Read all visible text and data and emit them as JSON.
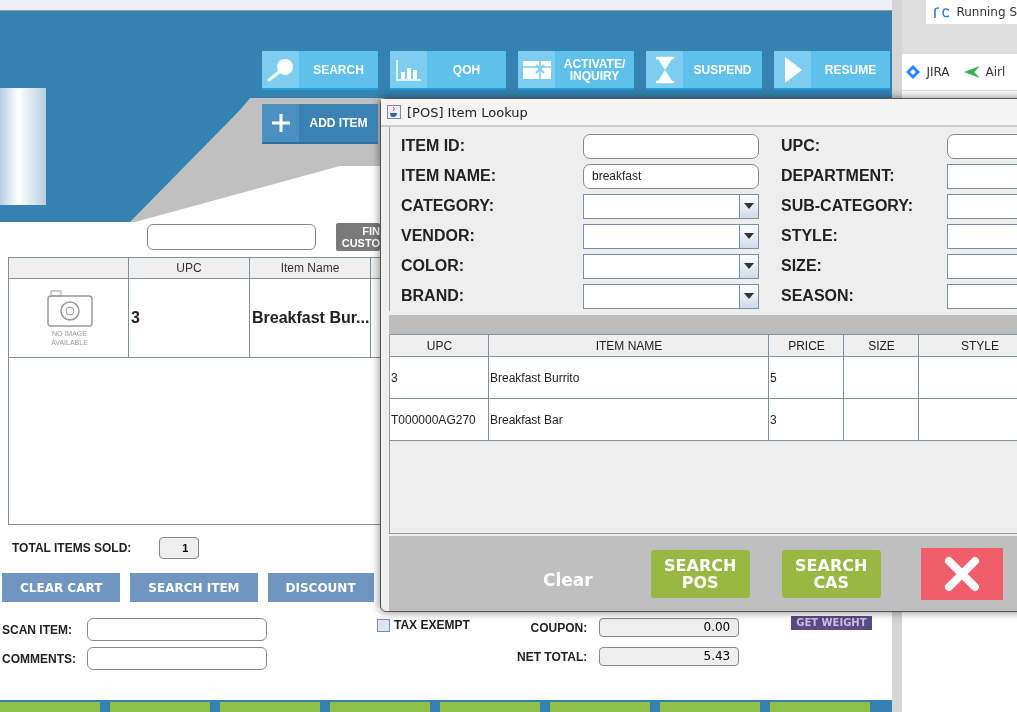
{
  "main_toolbar": [
    {
      "label": "SEARCH"
    },
    {
      "label": "QOH"
    },
    {
      "label": "ACTIVATE/ INQUIRY"
    },
    {
      "label": "SUSPEND"
    },
    {
      "label": "RESUME"
    }
  ],
  "add_item": {
    "label": "ADD ITEM"
  },
  "find_customer": {
    "label": "FIN CUSTO"
  },
  "cart": {
    "columns": [
      "UPC",
      "Item Name"
    ],
    "rows": [
      {
        "image_caption": "NO IMAGE AVAILABLE",
        "upc": "3",
        "item_name": "Breakfast Bur..."
      }
    ]
  },
  "total_items_sold": {
    "label": "TOTAL ITEMS SOLD:",
    "value": "1"
  },
  "cart_actions": [
    "CLEAR CART",
    "SEARCH ITEM",
    "DISCOUNT"
  ],
  "inputs": [
    {
      "label": "SCAN ITEM:"
    },
    {
      "label": "COMMENTS:"
    }
  ],
  "tax_exempt": {
    "label": "TAX EXEMPT",
    "checked": false
  },
  "totals": [
    {
      "label": "COUPON:",
      "value": "0.00"
    },
    {
      "label": "NET TOTAL:",
      "value": "5.43"
    }
  ],
  "get_weight": {
    "label": "GET WEIGHT"
  },
  "browser": {
    "tab": "Running S",
    "bookmarks": [
      "JIRA",
      "Airl"
    ]
  },
  "dialog": {
    "title": "[POS] Item Lookup",
    "fields": [
      [
        {
          "label": "ITEM ID:",
          "kind": "text"
        },
        {
          "label": "UPC:",
          "kind": "text"
        }
      ],
      [
        {
          "label": "ITEM NAME:",
          "kind": "text",
          "value": "breakfast"
        },
        {
          "label": "DEPARTMENT:",
          "kind": "box"
        }
      ],
      [
        {
          "label": "CATEGORY:",
          "kind": "combo"
        },
        {
          "label": "SUB-CATEGORY:",
          "kind": "box"
        }
      ],
      [
        {
          "label": "VENDOR:",
          "kind": "combo"
        },
        {
          "label": "STYLE:",
          "kind": "box"
        }
      ],
      [
        {
          "label": "COLOR:",
          "kind": "combo"
        },
        {
          "label": "SIZE:",
          "kind": "box"
        }
      ],
      [
        {
          "label": "BRAND:",
          "kind": "combo"
        },
        {
          "label": "SEASON:",
          "kind": "box"
        }
      ]
    ],
    "results": {
      "columns": [
        "UPC",
        "ITEM NAME",
        "PRICE",
        "SIZE",
        "STYLE"
      ],
      "rows": [
        [
          "3",
          "Breakfast Burrito",
          "5"
        ],
        [
          "T000000AG270",
          "Breakfast Bar",
          "3"
        ]
      ]
    },
    "clear": "Clear",
    "buttons": [
      "SEARCH POS",
      "SEARCH CAS"
    ]
  }
}
